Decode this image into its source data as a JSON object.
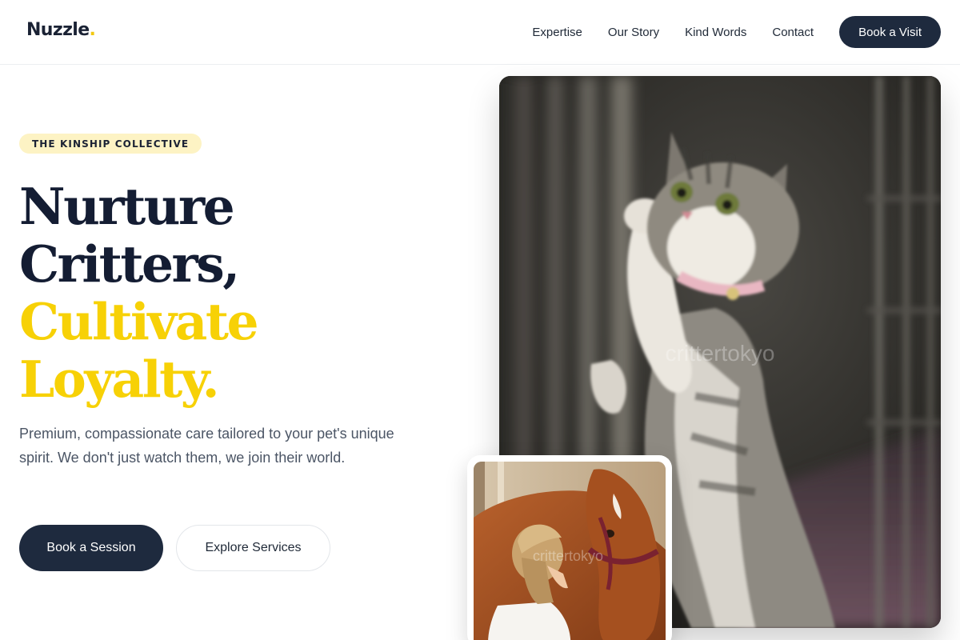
{
  "brand": {
    "name": "Nuzzle",
    "dot": ".",
    "accent_color": "#f2c811"
  },
  "nav": {
    "links": [
      "Expertise",
      "Our Story",
      "Kind Words",
      "Contact"
    ],
    "cta": "Book a Visit"
  },
  "hero": {
    "eyebrow": "THE KINSHIP COLLECTIVE",
    "headline": {
      "line1": "Nurture",
      "line2": "Critters,",
      "line3": "Cultivate",
      "line4": "Loyalty."
    },
    "subtext": "Premium, compassionate care tailored to your pet's unique spirit. We don't just watch them, we join their world.",
    "primary_button": "Book a Session",
    "secondary_button": "Explore Services"
  },
  "images": {
    "main": {
      "subject": "kitten reaching through cage bars",
      "watermark": "crittertokyo"
    },
    "secondary": {
      "subject": "woman with chestnut horse",
      "watermark": "crittertokyo"
    }
  },
  "colors": {
    "navy": "#1e2a3e",
    "headline_dark": "#141d33",
    "headline_yellow": "#f7d106",
    "eyebrow_bg": "#fdf3c4"
  }
}
